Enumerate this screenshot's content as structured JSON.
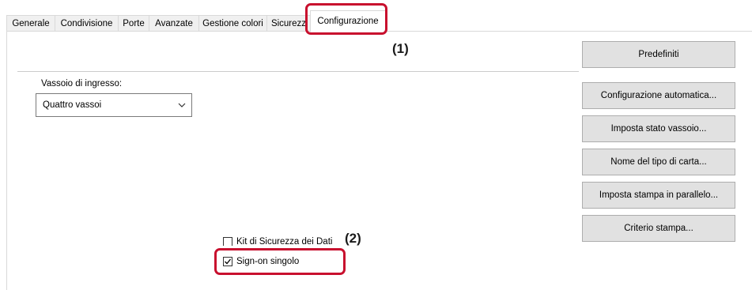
{
  "tabs": [
    {
      "label": "Generale"
    },
    {
      "label": "Condivisione"
    },
    {
      "label": "Porte"
    },
    {
      "label": "Avanzate"
    },
    {
      "label": "Gestione colori"
    },
    {
      "label": "Sicurezz"
    },
    {
      "label": "Configurazione",
      "active": true
    }
  ],
  "callouts": {
    "one": "(1)",
    "two": "(2)"
  },
  "input_tray": {
    "label": "Vassoio di ingresso:",
    "value": "Quattro vassoi"
  },
  "buttons": {
    "predefiniti": "Predefiniti",
    "auto_config": "Configurazione automatica...",
    "tray_status": "Imposta stato vassoio...",
    "paper_type": "Nome del tipo di carta...",
    "parallel_print": "Imposta stampa in parallelo...",
    "print_policy": "Criterio stampa..."
  },
  "checkboxes": {
    "data_security_kit": {
      "label": "Kit di Sicurezza dei Dati",
      "checked": false
    },
    "single_sign_on": {
      "label": "Sign-on singolo",
      "checked": true
    }
  },
  "colors": {
    "highlight": "#c8102e"
  }
}
